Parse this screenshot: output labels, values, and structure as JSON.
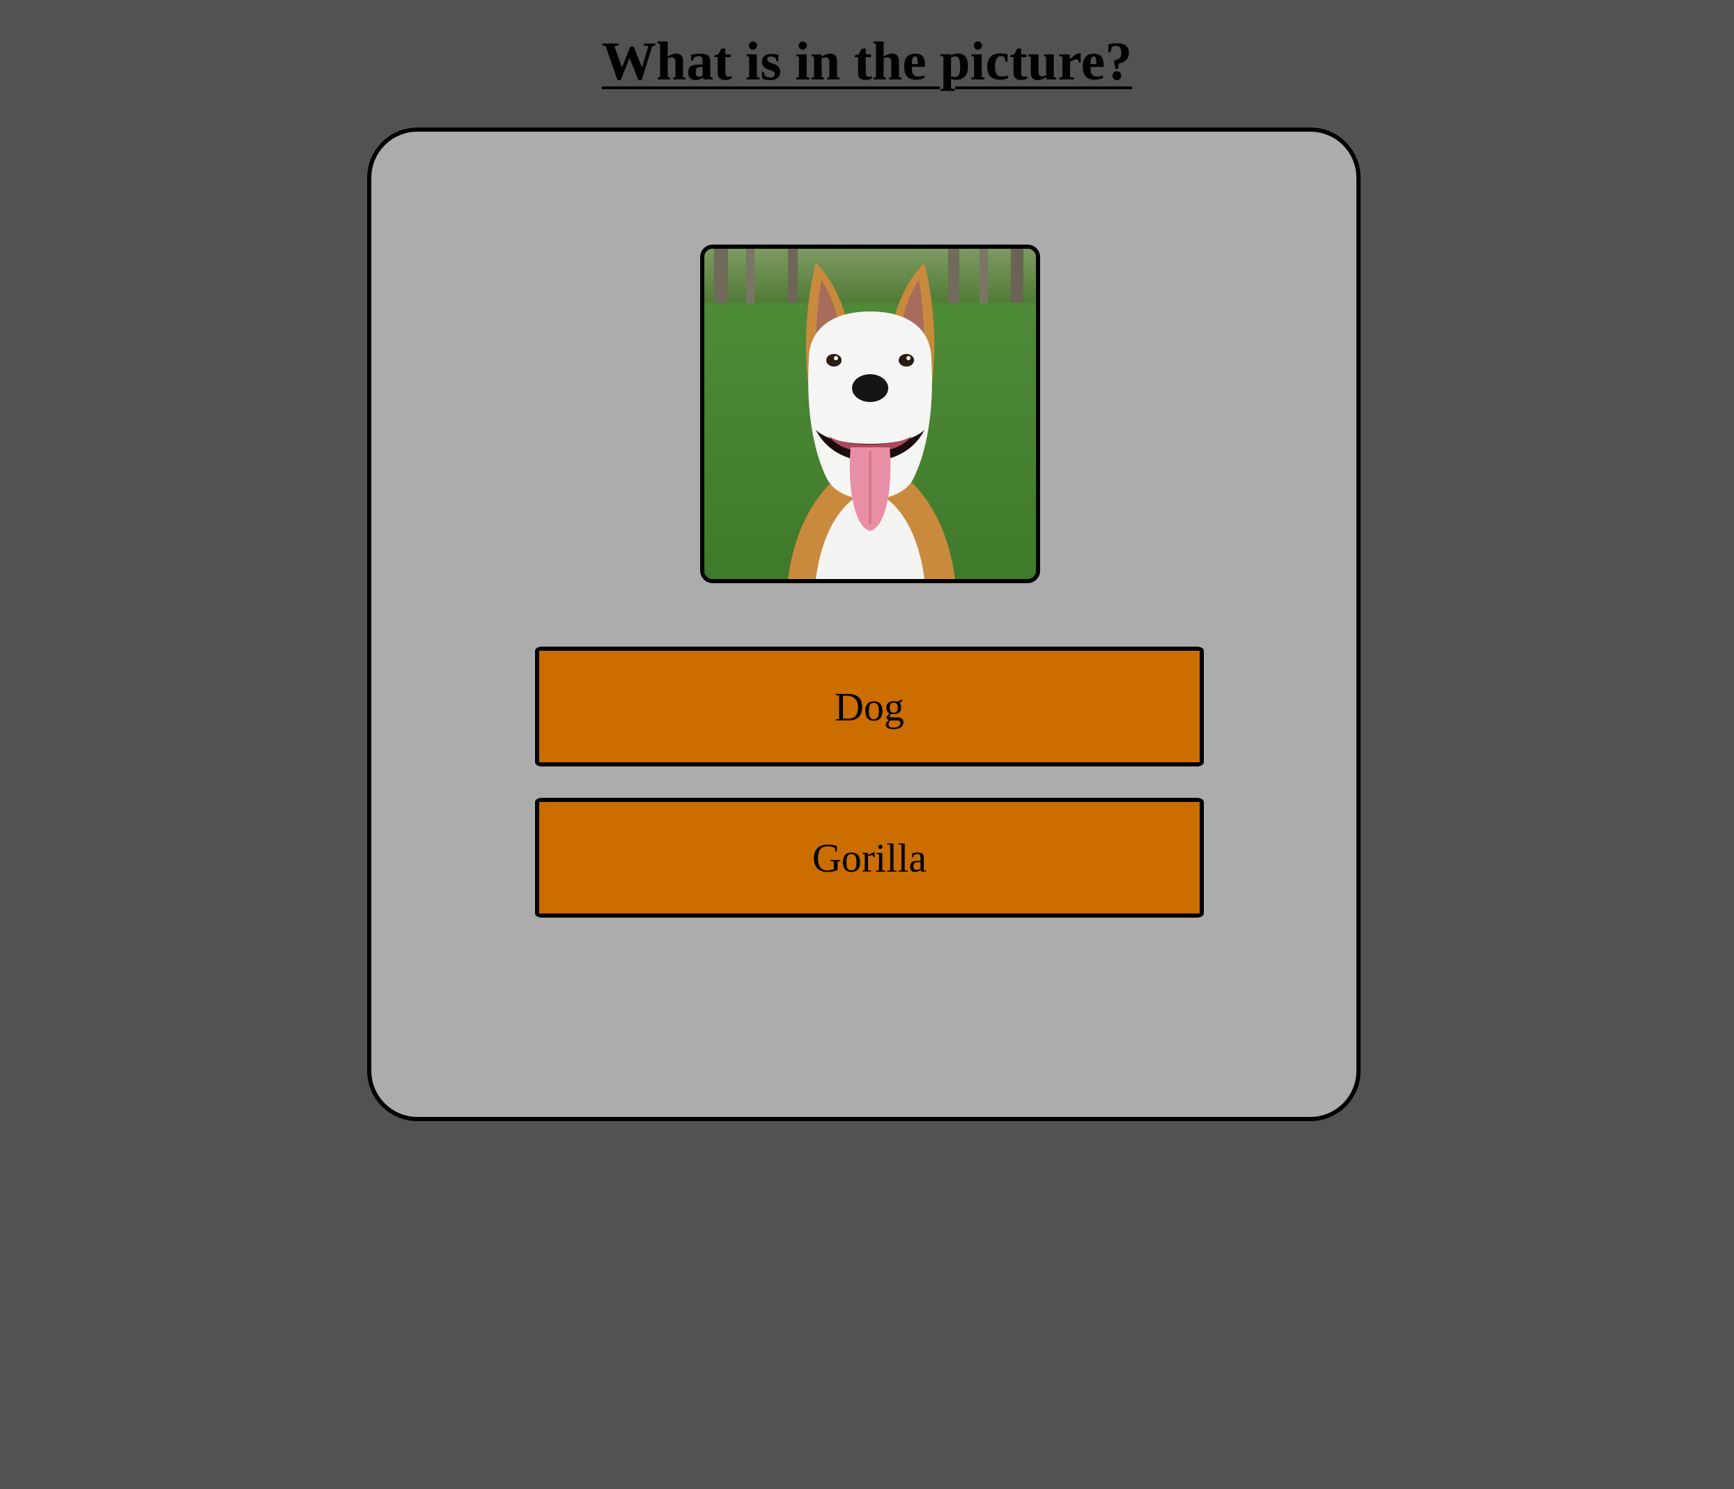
{
  "page": {
    "title": "What is in the picture?",
    "background_color": "#525252"
  },
  "quiz": {
    "card_color": "#acacac",
    "image": {
      "subject": "dog",
      "icon": "dog-photo"
    },
    "answers": [
      {
        "label": "Dog"
      },
      {
        "label": "Gorilla"
      }
    ],
    "button_color": "#cc6d00"
  }
}
